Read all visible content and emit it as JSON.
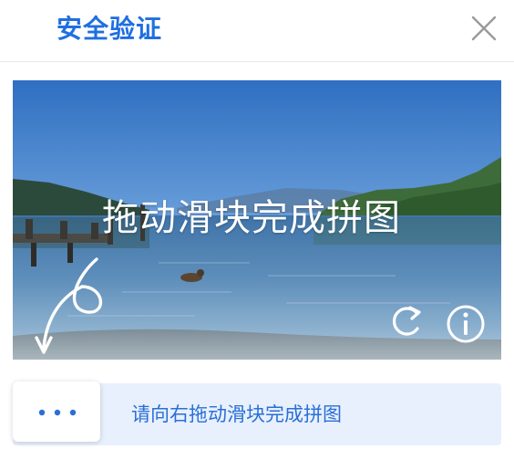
{
  "header": {
    "title": "安全验证",
    "close_icon": "close-icon"
  },
  "puzzle": {
    "image": "lake-with-pier-photo",
    "hint_text": "拖动滑块完成拼图",
    "refresh_icon": "refresh-icon",
    "info_icon": "info-icon"
  },
  "slider": {
    "handle_icon": "more-dots-icon",
    "instruction": "请向右拖动滑块完成拼图"
  },
  "colors": {
    "accent": "#1f6fe0",
    "track": "#e8f0fd",
    "instruction": "#2a6fd6"
  }
}
